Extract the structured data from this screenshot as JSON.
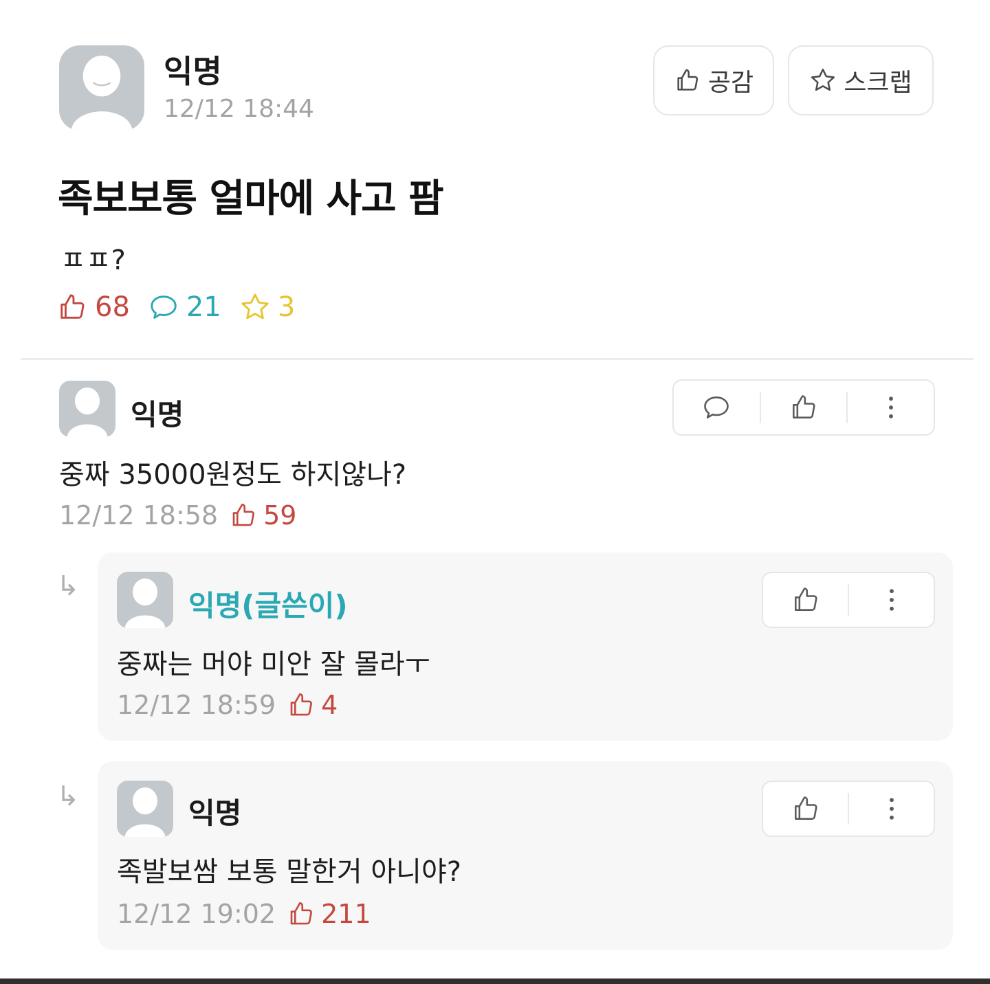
{
  "post": {
    "author": "익명",
    "time": "12/12 18:44",
    "title": "족보보통 얼마에 사고 팜",
    "body": "ㅍㅍ?",
    "likes": "68",
    "comments": "21",
    "scraps": "3",
    "like_button": "공감",
    "scrap_button": "스크랩"
  },
  "comments": [
    {
      "author": "익명",
      "text": "중짜 35000원정도 하지않나?",
      "time": "12/12 18:58",
      "likes": "59"
    }
  ],
  "replies": [
    {
      "author": "익명(글쓴이)",
      "text": "중짜는 머야 미안 잘 몰라ㅜ",
      "time": "12/12 18:59",
      "likes": "4"
    },
    {
      "author": "익명",
      "text": "족발보쌈 보통 말한거 아니야?",
      "time": "12/12 19:02",
      "likes": "211"
    }
  ],
  "reply_arrow": "↳",
  "colors": {
    "like": "#c4483f",
    "comment": "#2aa8b3",
    "scrap": "#e7c531",
    "op_author": "#2aa8b3",
    "avatar": "#c3c8cc"
  },
  "icons": [
    "thumbs-up-icon",
    "star-icon",
    "speech-bubble-icon",
    "more-vertical-icon",
    "reply-arrow-icon",
    "avatar-placeholder-icon"
  ]
}
